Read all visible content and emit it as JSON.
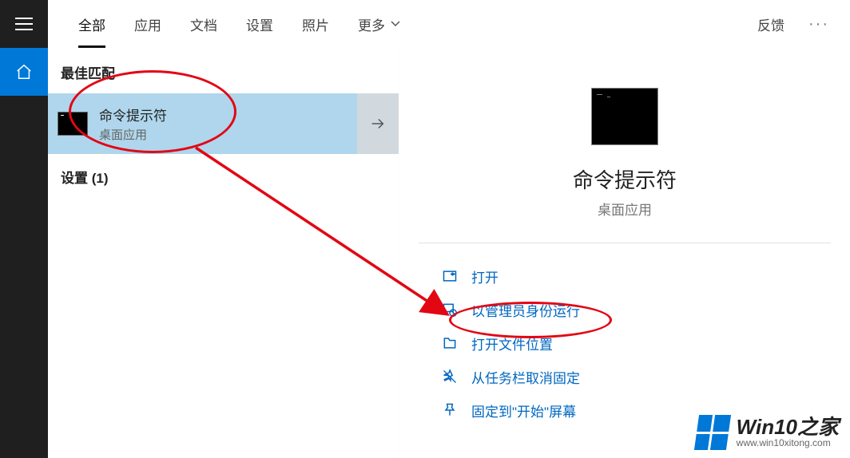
{
  "tabs": {
    "all": "全部",
    "apps": "应用",
    "docs": "文档",
    "settings": "设置",
    "photos": "照片",
    "more": "更多"
  },
  "header_actions": {
    "feedback": "反馈"
  },
  "results": {
    "best_match_header": "最佳匹配",
    "item": {
      "title": "命令提示符",
      "subtitle": "桌面应用"
    },
    "settings_header": "设置 (1)"
  },
  "preview": {
    "title": "命令提示符",
    "subtitle": "桌面应用",
    "actions": {
      "open": "打开",
      "run_as_admin": "以管理员身份运行",
      "open_file_location": "打开文件位置",
      "unpin_from_taskbar": "从任务栏取消固定",
      "pin_to_start": "固定到\"开始\"屏幕"
    }
  },
  "watermark": {
    "title": "Win10之家",
    "url": "www.win10xitong.com"
  }
}
